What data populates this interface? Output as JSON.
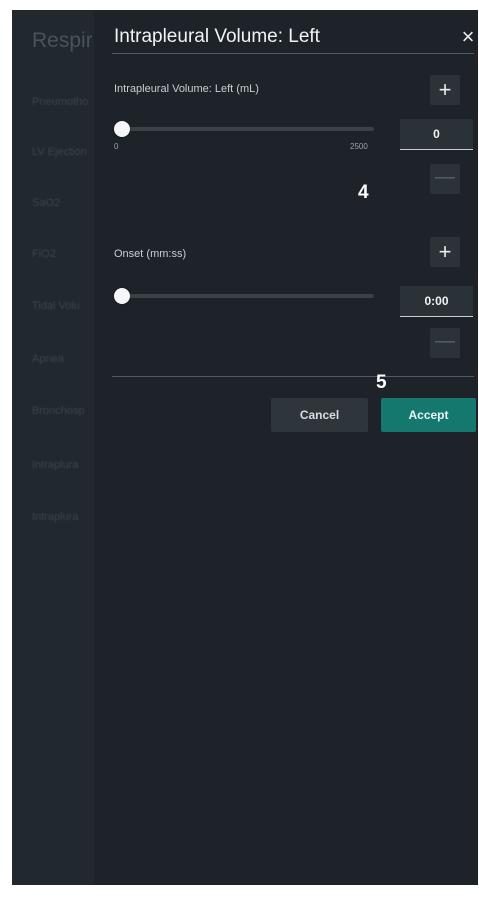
{
  "background": {
    "title": "Respira",
    "items": [
      "Pneumotho",
      "LV Ejection",
      "SaO2",
      "FiO2",
      "Tidal Volu",
      "Apnea",
      "Bronchosp",
      "Intraplura",
      "Intraplura"
    ]
  },
  "dialog": {
    "title": "Intrapleural Volume: Left",
    "close_icon": "×",
    "fields": [
      {
        "label": "Intrapleural Volume: Left (mL)",
        "value": "0",
        "min_label": "0",
        "max_label": "2500",
        "slider_fraction": 0,
        "plus": "+",
        "minus": "—"
      },
      {
        "label": "Onset (mm:ss)",
        "value": "0:00",
        "slider_fraction": 0,
        "plus": "+",
        "minus": "—"
      }
    ],
    "cancel_label": "Cancel",
    "accept_label": "Accept"
  },
  "annotations": {
    "marker_4": "4",
    "marker_5": "5"
  },
  "colors": {
    "accent": "#15786f",
    "background": "#1e2329"
  }
}
